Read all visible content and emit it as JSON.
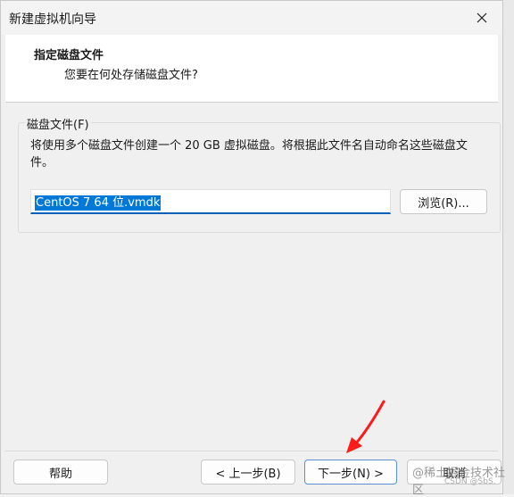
{
  "window": {
    "title": "新建虚拟机向导",
    "close_icon": "close-icon"
  },
  "header": {
    "title": "指定磁盘文件",
    "subtitle": "您要在何处存储磁盘文件?"
  },
  "disk_file_group": {
    "label": "磁盘文件(F)",
    "description": "将使用多个磁盘文件创建一个 20 GB 虚拟磁盘。将根据此文件名自动命名这些磁盘文件。",
    "filename_value": "CentOS 7 64 位.vmdk",
    "browse_label": "浏览(R)..."
  },
  "footer": {
    "help_label": "帮助",
    "back_label": "< 上一步(B)",
    "next_label": "下一步(N) >",
    "cancel_label": "取消"
  },
  "overlay": {
    "arrow_color": "#ff1a1a",
    "watermark": "@稀土掘金技术社区",
    "watermark_small": "CSDN @SbS."
  },
  "colors": {
    "accent": "#005fb8",
    "selection": "#0078d7"
  }
}
